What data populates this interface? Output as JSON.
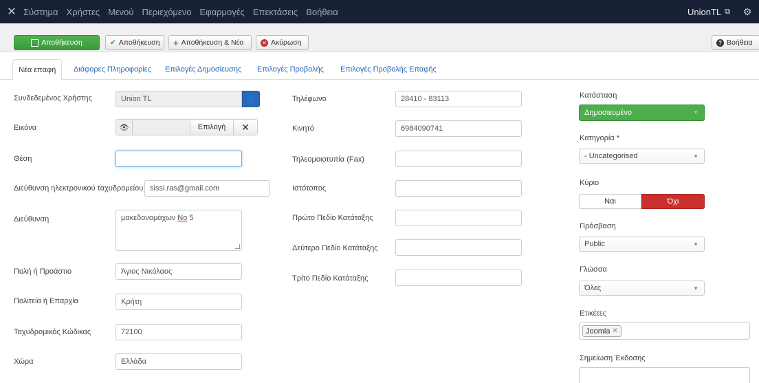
{
  "navbar": {
    "menu": [
      "Σύστημα",
      "Χρήστες",
      "Μενού",
      "Περιεχόμενο",
      "Εφαρμογές",
      "Επεκτάσεις",
      "Βοήθεια"
    ],
    "site_name": "UnionTL"
  },
  "toolbar": {
    "save": "Αποθήκευση",
    "save_close": "Αποθήκευση",
    "save_new": "Αποθήκευση & Νέο",
    "cancel": "Ακύρωση",
    "help": "Βοήθεια"
  },
  "tabs": [
    "Νέα επαφή",
    "Διάφορες Πληροφορίες",
    "Επιλογές Δημοσίευσης",
    "Επιλογές Προβολής",
    "Επιλογές Προβολής Επαφής"
  ],
  "left": {
    "linked_user": {
      "label": "Συνδεδεμένος Χρήστης",
      "value": "Union TL"
    },
    "image": {
      "label": "Εικόνα",
      "select": "Επιλογή"
    },
    "position": {
      "label": "Θέση",
      "value": ""
    },
    "email": {
      "label": "Διεύθυνση ηλεκτρονικού ταχυδρομείου",
      "value": "sissi.ras@gmail.com"
    },
    "address": {
      "label": "Διεύθυνση",
      "value_prefix": "μακεδονομάχων ",
      "value_underlined": "No",
      "value_suffix": " 5"
    },
    "suburb": {
      "label": "Πολή ή Προάστιο",
      "value": "Άγιος Νικόλαος"
    },
    "state": {
      "label": "Πολιτεία ή Επαρχία",
      "value": "Κρήτη"
    },
    "postcode": {
      "label": "Ταχυδρομικός Κώδικας",
      "value": "72100"
    },
    "country": {
      "label": "Χώρα",
      "value": "Ελλάδα"
    }
  },
  "middle": {
    "phone": {
      "label": "Τηλέφωνο",
      "value": "28410 - 83113"
    },
    "mobile": {
      "label": "Κινητό",
      "value": "6984090741"
    },
    "fax": {
      "label": "Τηλεομοιοτυπία (Fax)",
      "value": ""
    },
    "website": {
      "label": "Ιστότοπος",
      "value": ""
    },
    "sort1": {
      "label": "Πρώτο Πεδίο Κατάταξης",
      "value": ""
    },
    "sort2": {
      "label": "Δεύτερο Πεδίο Κατάταξης",
      "value": ""
    },
    "sort3": {
      "label": "Τρίτο Πεδίο Κατάταξης",
      "value": ""
    }
  },
  "right": {
    "status": {
      "label": "Κατάσταση",
      "value": "Δημοσιευμένο"
    },
    "category": {
      "label": "Κατηγορία *",
      "value": "- Uncategorised"
    },
    "featured": {
      "label": "Κύριο",
      "yes": "Ναι",
      "no": "Όχι",
      "selected": "Όχι"
    },
    "access": {
      "label": "Πρόσβαση",
      "value": "Public"
    },
    "language": {
      "label": "Γλώσσα",
      "value": "Όλες"
    },
    "tags": {
      "label": "Ετικέτες",
      "items": [
        "Joomla"
      ]
    },
    "version_note": {
      "label": "Σημείωση Έκδοσης",
      "value": ""
    }
  },
  "colors": {
    "navbar": "#182136",
    "primary": "#4cae4c",
    "link": "#2a69b8",
    "danger": "#c9302c"
  }
}
